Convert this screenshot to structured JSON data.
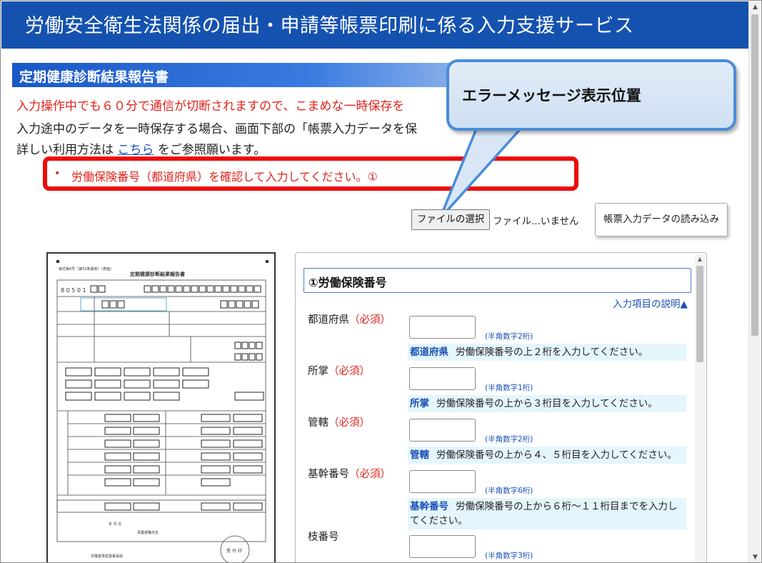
{
  "header": {
    "title": "労働安全衛生法関係の届出・申請等帳票印刷に係る入力支援サービス"
  },
  "section": {
    "title": "定期健康診断結果報告書"
  },
  "notices": {
    "timeout_warning": "入力操作中でも６０分で通信が切断されますので、こまめな一時保存を",
    "save_guidance": "入力途中のデータを一時保存する場合、画面下部の「帳票入力データを保",
    "usage_prefix": "詳しい利用方法は",
    "usage_link": "こちら",
    "usage_suffix": "をご参照願います。"
  },
  "error": {
    "bullet": "•",
    "message": "労働保険番号（都道府県）を確認して入力してください。①"
  },
  "callout": {
    "text": "エラーメッセージ表示位置"
  },
  "file_upload": {
    "choose_label": "ファイルの選択",
    "status": "ファイル...いません",
    "load_button": "帳票入力データの読み込み"
  },
  "form_preview": {
    "form_number": "様式第6号（第52条関係）（表面）",
    "doc_title": "定期健康診断結果報告書",
    "code_boxes": "8 0 5 0 1",
    "stamp": "受 付 印",
    "bottom_date": "年 月 日",
    "bottom_name": "事業者職氏名",
    "bottom_dest": "労働基準監督署長殿"
  },
  "input_panel": {
    "section_header": "①労働保険番号",
    "help_link": "入力項目の説明▲",
    "required_mark": "（必須）",
    "fields": [
      {
        "label": "都道府県",
        "required": true,
        "hint": "(半角数字2桁)",
        "keyword": "都道府県",
        "description": "労働保険番号の上２桁を入力してください。"
      },
      {
        "label": "所掌",
        "required": true,
        "hint": "(半角数字1桁)",
        "keyword": "所掌",
        "description": "労働保険番号の上から３桁目を入力してください。"
      },
      {
        "label": "管轄",
        "required": true,
        "hint": "(半角数字2桁)",
        "keyword": "管轄",
        "description": "労働保険番号の上から４、５桁目を入力してください。"
      },
      {
        "label": "基幹番号",
        "required": true,
        "hint": "(半角数字6桁)",
        "keyword": "基幹番号",
        "description": "労働保険番号の上から６桁〜１１桁目までを入力してください。"
      },
      {
        "label": "枝番号",
        "required": false,
        "hint": "(半角数字3桁)"
      }
    ]
  },
  "colors": {
    "header_bg": "#1552b0",
    "error_red": "#e0221b",
    "error_border": "#ee0a0a",
    "link_blue": "#1a4fb5",
    "callout_fill": "#d6e4f5",
    "callout_border": "#4a8cd9",
    "desc_bg": "#e4f6fc"
  }
}
